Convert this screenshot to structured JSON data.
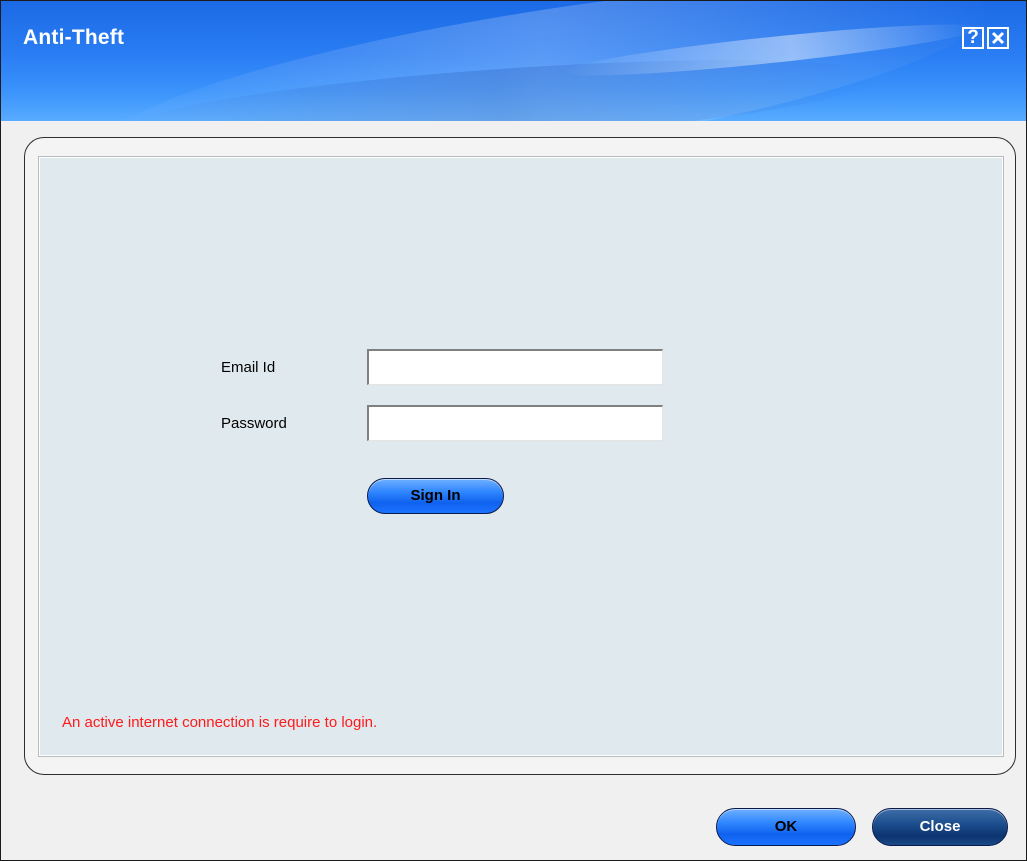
{
  "window": {
    "title": "Anti-Theft",
    "help_label": "?",
    "close_icon": "close-x-icon",
    "title_color": "#ffffff",
    "title_bar_color": "#2a7df3"
  },
  "form": {
    "email_label": "Email Id",
    "email_value": "",
    "password_label": "Password",
    "password_value": "",
    "signin_label": "Sign In",
    "notice": "An active internet connection is require to login.",
    "notice_color": "#ff1a1a",
    "panel_color": "#e0e9ee"
  },
  "footer": {
    "ok_label": "OK",
    "close_label": "Close"
  }
}
